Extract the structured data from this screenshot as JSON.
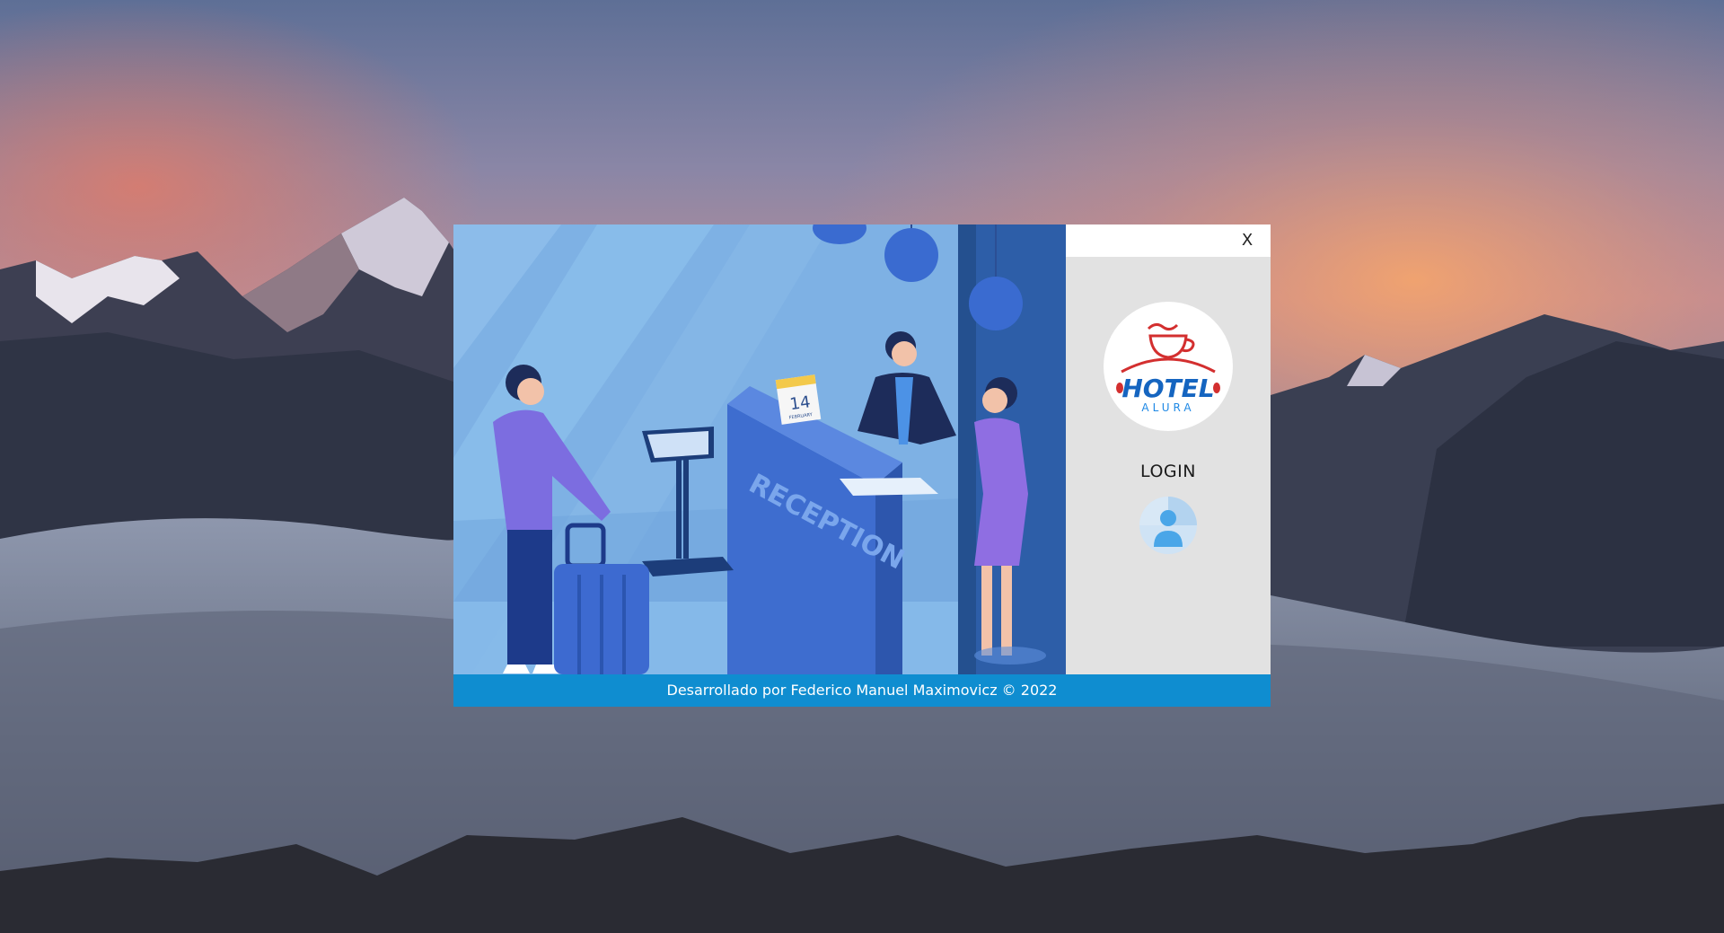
{
  "window": {
    "close_label": "X",
    "login_label": "LOGIN",
    "footer_text": "Desarrollado por Federico Manuel Maximovicz © 2022"
  },
  "logo": {
    "line1": "HOTEL",
    "line2": "ALURA"
  },
  "illustration": {
    "desk_text": "RECEPTION",
    "calendar_day": "14",
    "calendar_month": "FEBRUARY"
  },
  "colors": {
    "footer": "#0f8dd0",
    "side_panel": "#e2e2e2",
    "logo_red": "#d32f2f",
    "logo_blue": "#1e88e5"
  }
}
